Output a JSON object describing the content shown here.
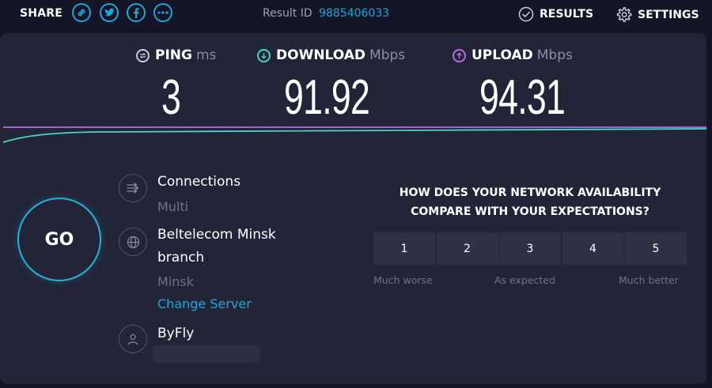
{
  "header": {
    "share_label": "SHARE",
    "share_icons": [
      "link-icon",
      "twitter-icon",
      "facebook-icon",
      "more-icon"
    ],
    "result_id_label": "Result ID",
    "result_id_value": "9885406033",
    "results_label": "RESULTS",
    "settings_label": "SETTINGS"
  },
  "metrics": {
    "ping": {
      "label": "PING",
      "unit": "ms",
      "value": "3"
    },
    "download": {
      "label": "DOWNLOAD",
      "unit": "Mbps",
      "value": "91.92"
    },
    "upload": {
      "label": "UPLOAD",
      "unit": "Mbps",
      "value": "94.31"
    }
  },
  "go_label": "GO",
  "server": {
    "connections_label": "Connections",
    "connections_value": "Multi",
    "server_name_line1": "Beltelecom Minsk",
    "server_name_line2": "branch",
    "server_location": "Minsk",
    "change_server_label": "Change Server",
    "isp_name": "ByFly"
  },
  "survey": {
    "question_line1": "HOW DOES YOUR NETWORK AVAILABILITY",
    "question_line2": "COMPARE WITH YOUR EXPECTATIONS?",
    "options": [
      "1",
      "2",
      "3",
      "4",
      "5"
    ],
    "low_label": "Much worse",
    "mid_label": "As expected",
    "high_label": "Much better"
  },
  "colors": {
    "accent": "#1ea6d8",
    "download": "#4fd1c5",
    "upload": "#b46de0",
    "panel": "#222437",
    "background": "#141526"
  }
}
